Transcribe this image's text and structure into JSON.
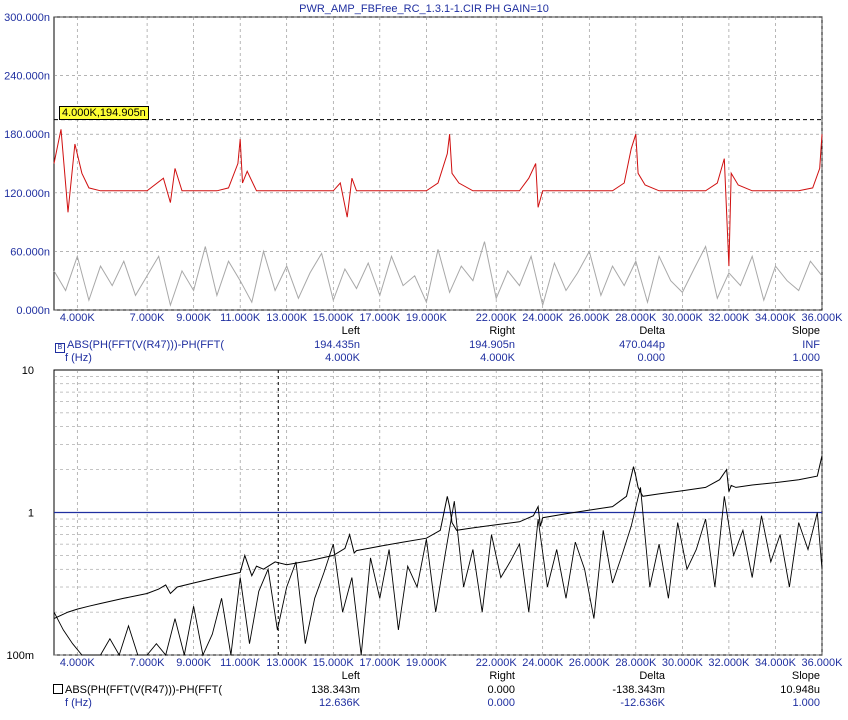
{
  "title": "PWR_AMP_FBFree_RC_1.3.1-1.CIR PH GAIN=10",
  "colors": {
    "upper_trace": "#d01010",
    "noise_trace": "#a8a8a8",
    "lower_trace": "#000000",
    "accent": "#1f2fa0",
    "grid": "#888888",
    "cursor_label_bg": "#ffff33"
  },
  "upper_panel": {
    "y_ticks": [
      "300.000n",
      "240.000n",
      "180.000n",
      "120.000n",
      "60.000n",
      "0.000n"
    ],
    "x_ticks": [
      "4.000K",
      "7.000K",
      "9.000K",
      "11.000K",
      "13.000K",
      "15.000K",
      "17.000K",
      "19.000K",
      "22.000K",
      "24.000K",
      "26.000K",
      "28.000K",
      "30.000K",
      "32.000K",
      "34.000K",
      "36.000K"
    ],
    "cursor_label": "4.000K,194.905n",
    "marker": "B",
    "readout": {
      "headers": [
        "Left",
        "Right",
        "Delta",
        "Slope"
      ],
      "row1": {
        "name": "ABS(PH(FFT(V(R47)))-PH(FFT(",
        "values": [
          "194.435n",
          "194.905n",
          "470.044p",
          "INF"
        ]
      },
      "row2": {
        "name": "f (Hz)",
        "values": [
          "4.000K",
          "4.000K",
          "0.000",
          "1.000"
        ]
      }
    }
  },
  "lower_panel": {
    "y_ticks": [
      "10",
      "1",
      "100m"
    ],
    "x_ticks": [
      "4.000K",
      "7.000K",
      "9.000K",
      "11.000K",
      "13.000K",
      "15.000K",
      "17.000K",
      "19.000K",
      "22.000K",
      "24.000K",
      "26.000K",
      "28.000K",
      "30.000K",
      "32.000K",
      "34.000K",
      "36.000K"
    ],
    "readout": {
      "headers": [
        "Left",
        "Right",
        "Delta",
        "Slope"
      ],
      "row1": {
        "name": "ABS(PH(FFT(V(R47)))-PH(FFT(",
        "values": [
          "138.343m",
          "0.000",
          "-138.343m",
          "10.948u"
        ]
      },
      "row2": {
        "name": "f (Hz)",
        "values": [
          "12.636K",
          "0.000",
          "-12.636K",
          "1.000"
        ]
      }
    }
  },
  "chart_data": [
    {
      "type": "line",
      "title": "PWR_AMP_FBFree_RC_1.3.1-1.CIR PH GAIN=10",
      "xlabel": "",
      "ylabel": "",
      "xlim": [
        3000,
        36000
      ],
      "ylim": [
        0,
        300
      ],
      "y_unit": "n",
      "grid": true,
      "x_tick_values": [
        4000,
        7000,
        9000,
        11000,
        13000,
        15000,
        17000,
        19000,
        22000,
        24000,
        26000,
        28000,
        30000,
        32000,
        34000,
        36000
      ],
      "y_tick_values": [
        0,
        60,
        120,
        180,
        240,
        300
      ],
      "cursor": {
        "x": 4000,
        "y": 194.905
      },
      "series": [
        {
          "role": "main",
          "x": [
            3000,
            3300,
            3600,
            3900,
            4200,
            4500,
            5000,
            6000,
            7000,
            7700,
            8000,
            8200,
            8500,
            9000,
            10000,
            10500,
            10900,
            11000,
            11100,
            11300,
            11700,
            12000,
            13000,
            14000,
            15000,
            15300,
            15600,
            15800,
            16000,
            17000,
            18000,
            19000,
            19500,
            19900,
            20000,
            20100,
            20400,
            21000,
            22000,
            23000,
            23400,
            23700,
            23800,
            24000,
            25000,
            26000,
            27000,
            27500,
            27800,
            28000,
            28100,
            28400,
            29000,
            30000,
            31000,
            31500,
            31800,
            32000,
            32100,
            32400,
            33000,
            34000,
            35000,
            35600,
            35900,
            36000
          ],
          "y": [
            150,
            185,
            100,
            170,
            140,
            125,
            122,
            122,
            122,
            135,
            110,
            145,
            122,
            122,
            122,
            125,
            150,
            175,
            130,
            142,
            122,
            122,
            122,
            122,
            122,
            130,
            95,
            135,
            122,
            122,
            122,
            122,
            130,
            160,
            180,
            140,
            130,
            122,
            122,
            122,
            135,
            150,
            105,
            122,
            122,
            122,
            122,
            130,
            165,
            180,
            140,
            128,
            122,
            122,
            122,
            130,
            155,
            45,
            140,
            128,
            122,
            122,
            122,
            125,
            145,
            180
          ]
        },
        {
          "role": "noise",
          "x": [
            3000,
            3500,
            4000,
            4500,
            5000,
            5500,
            6000,
            6500,
            7000,
            7500,
            8000,
            8500,
            9000,
            9500,
            10000,
            10500,
            11000,
            11500,
            12000,
            12500,
            13000,
            13500,
            14000,
            14500,
            15000,
            15500,
            16000,
            16500,
            17000,
            17500,
            18000,
            18500,
            19000,
            19500,
            20000,
            20500,
            21000,
            21500,
            22000,
            22500,
            23000,
            23500,
            24000,
            24500,
            25000,
            25500,
            26000,
            26500,
            27000,
            27500,
            28000,
            28500,
            29000,
            29500,
            30000,
            30500,
            31000,
            31500,
            32000,
            32500,
            33000,
            33500,
            34000,
            34500,
            35000,
            35500,
            36000
          ],
          "y": [
            40,
            20,
            55,
            10,
            45,
            25,
            50,
            15,
            35,
            55,
            5,
            40,
            20,
            65,
            15,
            50,
            30,
            8,
            60,
            20,
            45,
            12,
            38,
            58,
            10,
            42,
            22,
            48,
            15,
            55,
            25,
            35,
            8,
            62,
            18,
            45,
            30,
            70,
            12,
            40,
            25,
            55,
            5,
            48,
            20,
            38,
            60,
            15,
            45,
            25,
            50,
            8,
            55,
            30,
            18,
            42,
            65,
            12,
            38,
            25,
            55,
            10,
            45,
            30,
            20,
            50,
            35
          ]
        }
      ]
    },
    {
      "type": "line",
      "xlabel": "",
      "ylabel": "",
      "xlim": [
        3000,
        36000
      ],
      "ylim": [
        0.1,
        10
      ],
      "y_scale": "log",
      "grid": true,
      "x_tick_values": [
        4000,
        7000,
        9000,
        11000,
        13000,
        15000,
        17000,
        19000,
        22000,
        24000,
        26000,
        28000,
        30000,
        32000,
        34000,
        36000
      ],
      "y_tick_values": [
        0.1,
        1,
        10
      ],
      "reference_line": 1,
      "cursor": {
        "x": 12636
      },
      "series": [
        {
          "role": "main",
          "x": [
            3000,
            3300,
            3600,
            4000,
            4500,
            5000,
            6000,
            7000,
            7500,
            7800,
            8000,
            8300,
            9000,
            10000,
            11000,
            11200,
            11500,
            11700,
            12000,
            12500,
            13000,
            14000,
            15000,
            15500,
            15700,
            15900,
            16000,
            17000,
            18000,
            19000,
            19600,
            19900,
            20000,
            20100,
            20300,
            21000,
            22000,
            23000,
            23600,
            23800,
            23900,
            24000,
            25000,
            26000,
            27000,
            27600,
            27900,
            28000,
            28100,
            28300,
            29000,
            30000,
            31000,
            31600,
            31900,
            32000,
            32100,
            32300,
            33000,
            34000,
            35000,
            35800,
            36000
          ],
          "y": [
            0.18,
            0.19,
            0.2,
            0.21,
            0.22,
            0.23,
            0.25,
            0.27,
            0.29,
            0.31,
            0.27,
            0.3,
            0.32,
            0.35,
            0.38,
            0.5,
            0.36,
            0.42,
            0.4,
            0.45,
            0.43,
            0.46,
            0.5,
            0.56,
            0.7,
            0.52,
            0.54,
            0.58,
            0.62,
            0.66,
            0.75,
            1.3,
            1.1,
            0.85,
            0.75,
            0.78,
            0.82,
            0.86,
            0.95,
            1.1,
            0.8,
            0.92,
            0.98,
            1.04,
            1.1,
            1.3,
            2.1,
            1.8,
            1.5,
            1.3,
            1.35,
            1.42,
            1.5,
            1.7,
            2.0,
            1.4,
            1.55,
            1.5,
            1.56,
            1.62,
            1.7,
            1.8,
            2.5
          ]
        },
        {
          "role": "noise",
          "x": [
            3000,
            3400,
            3800,
            4200,
            4600,
            5000,
            5400,
            5800,
            6200,
            6600,
            7000,
            7400,
            7800,
            8200,
            8600,
            9000,
            9400,
            9800,
            10200,
            10600,
            11000,
            11400,
            11800,
            12200,
            12600,
            13000,
            13400,
            13800,
            14200,
            14600,
            15000,
            15400,
            15800,
            16200,
            16600,
            17000,
            17400,
            17800,
            18200,
            18600,
            19000,
            19400,
            19800,
            20200,
            20600,
            21000,
            21400,
            21800,
            22200,
            22600,
            23000,
            23400,
            23800,
            24200,
            24600,
            25000,
            25400,
            25800,
            26200,
            26600,
            27000,
            27400,
            27800,
            28200,
            28600,
            29000,
            29400,
            29800,
            30200,
            30600,
            31000,
            31400,
            31800,
            32200,
            32600,
            33000,
            33400,
            33800,
            34200,
            34600,
            35000,
            35400,
            35800,
            36000
          ],
          "y": [
            0.2,
            0.15,
            0.12,
            0.1,
            0.1,
            0.1,
            0.13,
            0.1,
            0.16,
            0.1,
            0.1,
            0.12,
            0.1,
            0.18,
            0.1,
            0.22,
            0.1,
            0.14,
            0.25,
            0.1,
            0.35,
            0.12,
            0.28,
            0.4,
            0.15,
            0.3,
            0.45,
            0.12,
            0.25,
            0.38,
            0.6,
            0.2,
            0.35,
            0.1,
            0.48,
            0.25,
            0.55,
            0.15,
            0.42,
            0.3,
            0.65,
            0.2,
            0.5,
            1.2,
            0.3,
            0.55,
            0.2,
            0.7,
            0.35,
            0.45,
            0.6,
            0.2,
            0.9,
            0.3,
            0.55,
            0.25,
            0.62,
            0.4,
            0.18,
            0.75,
            0.32,
            0.5,
            0.8,
            1.5,
            0.3,
            0.6,
            0.25,
            0.85,
            0.4,
            0.55,
            0.9,
            0.3,
            1.3,
            0.5,
            0.75,
            0.35,
            0.95,
            0.45,
            0.7,
            0.3,
            0.85,
            0.55,
            1.0,
            0.4
          ]
        }
      ]
    }
  ]
}
